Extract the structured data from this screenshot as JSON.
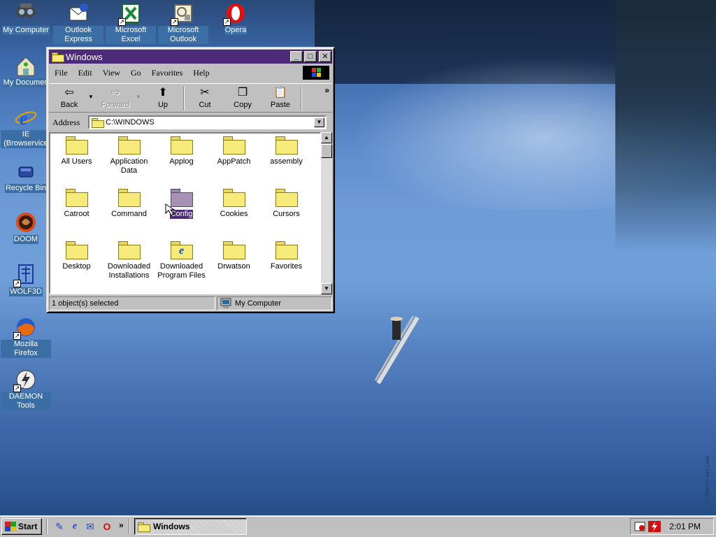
{
  "desktop": {
    "icons": [
      {
        "label": "My Computer",
        "icon": "my-computer-icon"
      },
      {
        "label": "Outlook Express",
        "icon": "outlook-express-icon"
      },
      {
        "label": "Microsoft Excel",
        "icon": "excel-icon"
      },
      {
        "label": "Microsoft Outlook",
        "icon": "outlook-icon"
      },
      {
        "label": "Opera",
        "icon": "opera-icon"
      },
      {
        "label": "My Documen",
        "icon": "my-documents-icon"
      },
      {
        "label": "IE (Browservice",
        "icon": "ie-icon"
      },
      {
        "label": "Recycle Bin",
        "icon": "recycle-bin-icon"
      },
      {
        "label": "DOOM",
        "icon": "doom-icon"
      },
      {
        "label": "WOLF3D",
        "icon": "wolf3d-icon"
      },
      {
        "label": "Mozilla Firefox",
        "icon": "firefox-icon"
      },
      {
        "label": "DAEMON Tools",
        "icon": "daemon-tools-icon"
      }
    ]
  },
  "window": {
    "title": "Windows",
    "menu": [
      "File",
      "Edit",
      "View",
      "Go",
      "Favorites",
      "Help"
    ],
    "toolbar": {
      "back": "Back",
      "forward": "Forward",
      "up": "Up",
      "cut": "Cut",
      "copy": "Copy",
      "paste": "Paste",
      "more": "»"
    },
    "address_label": "Address",
    "address_value": "C:\\WINDOWS",
    "items": [
      {
        "name": "All Users",
        "type": "folder"
      },
      {
        "name": "Application Data",
        "type": "folder"
      },
      {
        "name": "Applog",
        "type": "folder"
      },
      {
        "name": "AppPatch",
        "type": "folder"
      },
      {
        "name": "assembly",
        "type": "folder"
      },
      {
        "name": "Catroot",
        "type": "folder"
      },
      {
        "name": "Command",
        "type": "folder"
      },
      {
        "name": "Config",
        "type": "folder",
        "selected": true
      },
      {
        "name": "Cookies",
        "type": "folder"
      },
      {
        "name": "Cursors",
        "type": "folder"
      },
      {
        "name": "Desktop",
        "type": "folder"
      },
      {
        "name": "Downloaded Installations",
        "type": "folder"
      },
      {
        "name": "Downloaded Program Files",
        "type": "ie-folder"
      },
      {
        "name": "Drwatson",
        "type": "folder"
      },
      {
        "name": "Favorites",
        "type": "folder"
      }
    ],
    "status_left": "1 object(s) selected",
    "status_right": "My Computer"
  },
  "taskbar": {
    "start": "Start",
    "quicklaunch_more": "»",
    "task": "Windows",
    "clock": "2:01 PM"
  },
  "wallpaper": {
    "credit": "© Darren van Laar"
  },
  "colors": {
    "titlebar": "#4b2a7a",
    "selection": "#4b2a7a",
    "face": "#c0c0c0",
    "desktop_label_bg": "#3a6ea5"
  }
}
